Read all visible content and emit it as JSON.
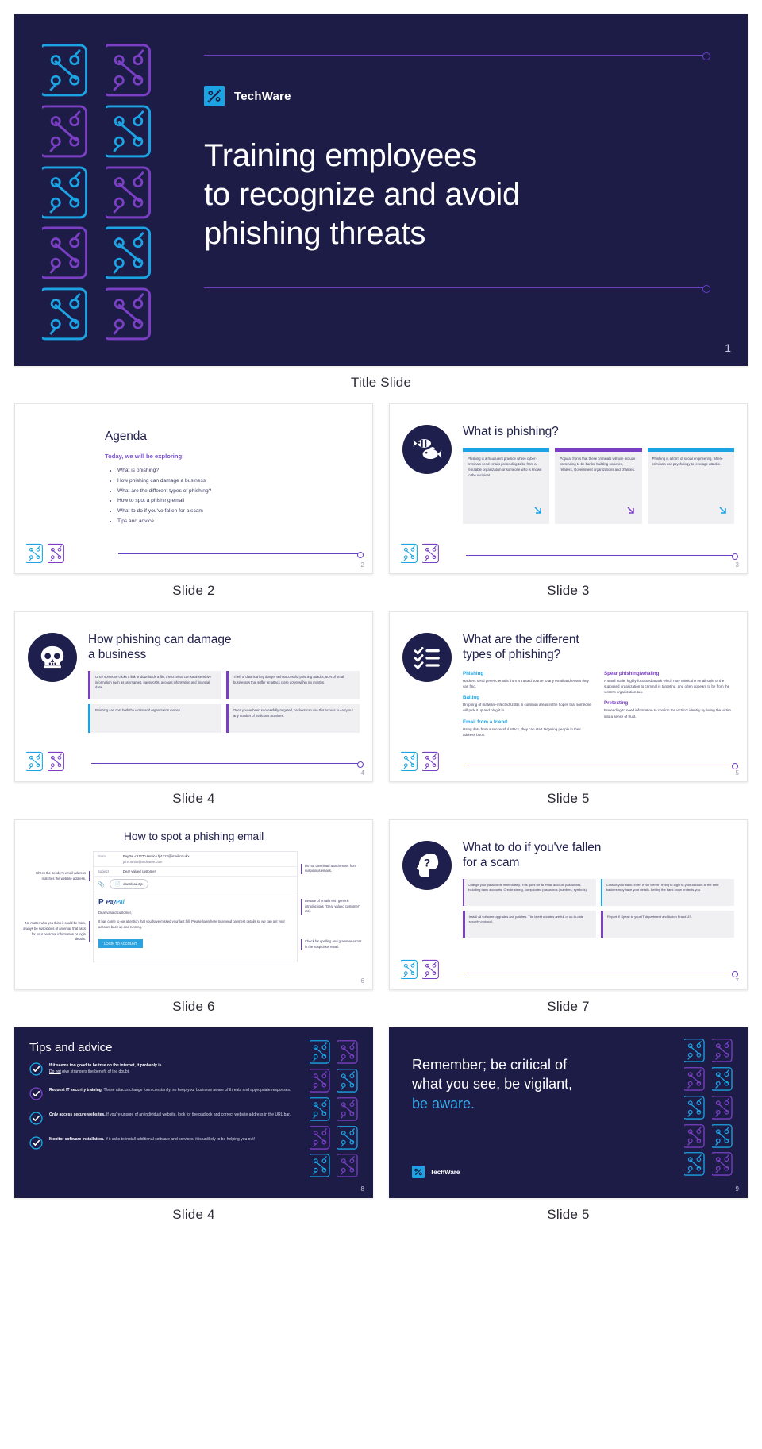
{
  "deck": {
    "brand": "TechWare",
    "slide1": {
      "title_lines": [
        "Training employees",
        "to recognize and avoid",
        "phishing threats"
      ],
      "page": "1",
      "caption": "Title Slide"
    },
    "slide2": {
      "title": "Agenda",
      "subtitle": "Today, we will be exploring:",
      "bullets": [
        "What is phishing?",
        "How phishing can damage a business",
        "What are the different types of phishing?",
        "How to spot a phishing email",
        "What to do if you've fallen for a scam",
        "Tips and advice"
      ],
      "page": "2",
      "caption": "Slide 2"
    },
    "slide3": {
      "title": "What is phishing?",
      "icon": "fish-icon",
      "cards": [
        {
          "color": "#1ba3e3",
          "text": "Phishing is a fraudulent practice where cyber-criminals send emails pretending to be from a reputable organization or someone who is known to the recipient."
        },
        {
          "color": "#7b3fc4",
          "text": "Popular fronts that these criminals will use include pretending to be banks, building societies, retailers, Government organizations and charities."
        },
        {
          "color": "#1ba3e3",
          "text": "Phishing is a form of social engineering, where criminals use psychology to leverage attacks."
        }
      ],
      "page": "3",
      "caption": "Slide 3"
    },
    "slide4": {
      "title_lines": [
        "How phishing can damage",
        "a business"
      ],
      "icon": "skull-icon",
      "cards": [
        {
          "color": "#7b3fc4",
          "text": "Once someone clicks a link or downloads a file, the criminal can steal sensitive information such as usernames, passwords, account information and financial data."
        },
        {
          "color": "#7b3fc4",
          "text": "Theft of data is a key danger with successful phishing attacks; 60% of small businesses that suffer an attack close down within six months."
        },
        {
          "color": "#1ba3e3",
          "text": "Phishing can cost both the victim and organization money."
        },
        {
          "color": "#7b3fc4",
          "text": "Once you've been successfully targeted, hackers can use this access to carry out any number of malicious activities."
        }
      ],
      "page": "4",
      "caption": "Slide 4"
    },
    "slide5": {
      "title_lines": [
        "What are the different",
        "types of phishing?"
      ],
      "icon": "checklist-icon",
      "terms": [
        {
          "term": "Phishing",
          "color": "#1ba3e3",
          "body": "Hackers send generic emails from a trusted source to any email addresses they can find."
        },
        {
          "term": "Baiting",
          "color": "#1ba3e3",
          "body": "Dropping of malware-infected USBs in common areas in the hopes that someone will pick it up and plug it in."
        },
        {
          "term": "Email from a friend",
          "color": "#1ba3e3",
          "body": "Using data from a successful attack, they can start targeting people in their address book."
        },
        {
          "term": "Spear phishing/whaling",
          "color": "#7b3fc4",
          "body": "A small scale, highly-focussed attack which may mimic the email style of the supposed organization to criminal is targeting, and often appears to be from the victim's organization too."
        },
        {
          "term": "Pretexting",
          "color": "#7b3fc4",
          "body": "Pretending to need information to confirm the victim's identity by luring the victim into a sense of trust."
        }
      ],
      "page": "5",
      "caption": "Slide 5"
    },
    "slide6": {
      "title": "How to spot a phishing email",
      "annotations_left": [
        "Check the sender's email address matches the website address.",
        "No matter who you think it could be from, always be suspicious of an email that asks for your personal information or login details."
      ],
      "annotations_right": [
        "Do not download attachments from suspicious emails.",
        "Beware of emails with generic introductions ('Dear valued customer' etc).",
        "Check for spelling and grammar errors in the suspicious email."
      ],
      "email": {
        "from_label": "From",
        "from_value": "PayPal <01270.service.fp1322@imail.co.uk>",
        "from_value2": "john.smith@techware.com",
        "subject_label": "Subject",
        "subject_value": "Dear valued customer",
        "attachment": "download.zip",
        "logo": "PayPal",
        "greeting": "Dear valued customer,",
        "body": "It has come to our attention that you have missed your last bill. Please login here to amend payment details so we can get your account back up and running.",
        "button": "LOGIN TO ACCOUNT"
      },
      "page": "6",
      "caption": "Slide 6"
    },
    "slide7": {
      "title_lines": [
        "What to do if you've fallen",
        "for a scam"
      ],
      "icon": "question-head-icon",
      "cards": [
        {
          "color": "#7b3fc4",
          "text": "Change your passwords immediately. This goes for all email account passwords, including bank accounts. Create strong, complicated passwords (numbers, symbols)."
        },
        {
          "color": "#1ba3e3",
          "text": "Contact your bank. Even if you weren't trying to login to your account at the time, hackers may have your details. Letting the bank know protects you."
        },
        {
          "color": "#7b3fc4",
          "text": "Install all software upgrades and patches. The latest updates are full of up-to-date security protocol."
        },
        {
          "color": "#7b3fc4",
          "text": "Report it! Speak to your IT department and Action Fraud US."
        }
      ],
      "page": "7",
      "caption": "Slide 7"
    },
    "slide8": {
      "title": "Tips and advice",
      "tips": [
        {
          "lead": "If it seems too good to be true on the internet, it probably is.",
          "emph": "Do not",
          "rest": "give strangers the benefit of the doubt."
        },
        {
          "lead": "",
          "emph": "Request IT security training.",
          "rest": "These attacks change form constantly, so keep your business aware of threats and appropriate responses."
        },
        {
          "lead": "",
          "emph": "Only access secure websites.",
          "rest": "If you're unsure of an individual website, look for the padlock and correct website address in the URL bar."
        },
        {
          "lead": "",
          "emph": "Monitor software installation.",
          "rest": "If it asks to install additional software and services, it is unlikely to be helping you out!"
        }
      ],
      "page": "8",
      "caption": "Slide 4"
    },
    "slide9": {
      "title_lines": [
        "Remember; be critical of",
        "what you see, be vigilant,"
      ],
      "highlight_line": "be aware.",
      "brand": "TechWare",
      "page": "9",
      "caption": "Slide 5"
    }
  },
  "colors": {
    "navy": "#1c1c47",
    "purple": "#7b3fc4",
    "blue": "#1ba3e3",
    "light_blue": "#36a9e8",
    "card_bg": "#f0f0f3"
  }
}
